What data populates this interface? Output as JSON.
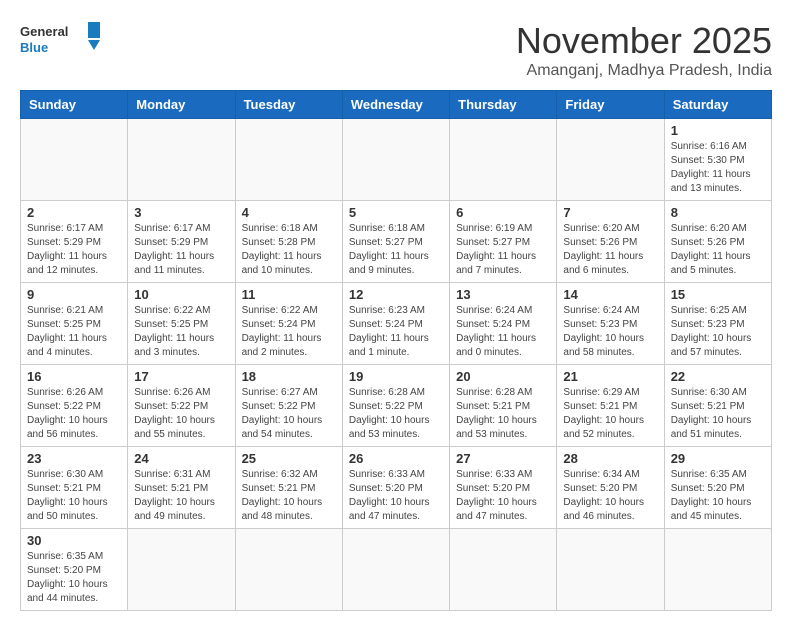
{
  "header": {
    "logo_general": "General",
    "logo_blue": "Blue",
    "month_year": "November 2025",
    "location": "Amanganj, Madhya Pradesh, India"
  },
  "weekdays": [
    "Sunday",
    "Monday",
    "Tuesday",
    "Wednesday",
    "Thursday",
    "Friday",
    "Saturday"
  ],
  "weeks": [
    [
      {
        "day": "",
        "info": ""
      },
      {
        "day": "",
        "info": ""
      },
      {
        "day": "",
        "info": ""
      },
      {
        "day": "",
        "info": ""
      },
      {
        "day": "",
        "info": ""
      },
      {
        "day": "",
        "info": ""
      },
      {
        "day": "1",
        "info": "Sunrise: 6:16 AM\nSunset: 5:30 PM\nDaylight: 11 hours\nand 13 minutes."
      }
    ],
    [
      {
        "day": "2",
        "info": "Sunrise: 6:17 AM\nSunset: 5:29 PM\nDaylight: 11 hours\nand 12 minutes."
      },
      {
        "day": "3",
        "info": "Sunrise: 6:17 AM\nSunset: 5:29 PM\nDaylight: 11 hours\nand 11 minutes."
      },
      {
        "day": "4",
        "info": "Sunrise: 6:18 AM\nSunset: 5:28 PM\nDaylight: 11 hours\nand 10 minutes."
      },
      {
        "day": "5",
        "info": "Sunrise: 6:18 AM\nSunset: 5:27 PM\nDaylight: 11 hours\nand 9 minutes."
      },
      {
        "day": "6",
        "info": "Sunrise: 6:19 AM\nSunset: 5:27 PM\nDaylight: 11 hours\nand 7 minutes."
      },
      {
        "day": "7",
        "info": "Sunrise: 6:20 AM\nSunset: 5:26 PM\nDaylight: 11 hours\nand 6 minutes."
      },
      {
        "day": "8",
        "info": "Sunrise: 6:20 AM\nSunset: 5:26 PM\nDaylight: 11 hours\nand 5 minutes."
      }
    ],
    [
      {
        "day": "9",
        "info": "Sunrise: 6:21 AM\nSunset: 5:25 PM\nDaylight: 11 hours\nand 4 minutes."
      },
      {
        "day": "10",
        "info": "Sunrise: 6:22 AM\nSunset: 5:25 PM\nDaylight: 11 hours\nand 3 minutes."
      },
      {
        "day": "11",
        "info": "Sunrise: 6:22 AM\nSunset: 5:24 PM\nDaylight: 11 hours\nand 2 minutes."
      },
      {
        "day": "12",
        "info": "Sunrise: 6:23 AM\nSunset: 5:24 PM\nDaylight: 11 hours\nand 1 minute."
      },
      {
        "day": "13",
        "info": "Sunrise: 6:24 AM\nSunset: 5:24 PM\nDaylight: 11 hours\nand 0 minutes."
      },
      {
        "day": "14",
        "info": "Sunrise: 6:24 AM\nSunset: 5:23 PM\nDaylight: 10 hours\nand 58 minutes."
      },
      {
        "day": "15",
        "info": "Sunrise: 6:25 AM\nSunset: 5:23 PM\nDaylight: 10 hours\nand 57 minutes."
      }
    ],
    [
      {
        "day": "16",
        "info": "Sunrise: 6:26 AM\nSunset: 5:22 PM\nDaylight: 10 hours\nand 56 minutes."
      },
      {
        "day": "17",
        "info": "Sunrise: 6:26 AM\nSunset: 5:22 PM\nDaylight: 10 hours\nand 55 minutes."
      },
      {
        "day": "18",
        "info": "Sunrise: 6:27 AM\nSunset: 5:22 PM\nDaylight: 10 hours\nand 54 minutes."
      },
      {
        "day": "19",
        "info": "Sunrise: 6:28 AM\nSunset: 5:22 PM\nDaylight: 10 hours\nand 53 minutes."
      },
      {
        "day": "20",
        "info": "Sunrise: 6:28 AM\nSunset: 5:21 PM\nDaylight: 10 hours\nand 53 minutes."
      },
      {
        "day": "21",
        "info": "Sunrise: 6:29 AM\nSunset: 5:21 PM\nDaylight: 10 hours\nand 52 minutes."
      },
      {
        "day": "22",
        "info": "Sunrise: 6:30 AM\nSunset: 5:21 PM\nDaylight: 10 hours\nand 51 minutes."
      }
    ],
    [
      {
        "day": "23",
        "info": "Sunrise: 6:30 AM\nSunset: 5:21 PM\nDaylight: 10 hours\nand 50 minutes."
      },
      {
        "day": "24",
        "info": "Sunrise: 6:31 AM\nSunset: 5:21 PM\nDaylight: 10 hours\nand 49 minutes."
      },
      {
        "day": "25",
        "info": "Sunrise: 6:32 AM\nSunset: 5:21 PM\nDaylight: 10 hours\nand 48 minutes."
      },
      {
        "day": "26",
        "info": "Sunrise: 6:33 AM\nSunset: 5:20 PM\nDaylight: 10 hours\nand 47 minutes."
      },
      {
        "day": "27",
        "info": "Sunrise: 6:33 AM\nSunset: 5:20 PM\nDaylight: 10 hours\nand 47 minutes."
      },
      {
        "day": "28",
        "info": "Sunrise: 6:34 AM\nSunset: 5:20 PM\nDaylight: 10 hours\nand 46 minutes."
      },
      {
        "day": "29",
        "info": "Sunrise: 6:35 AM\nSunset: 5:20 PM\nDaylight: 10 hours\nand 45 minutes."
      }
    ],
    [
      {
        "day": "30",
        "info": "Sunrise: 6:35 AM\nSunset: 5:20 PM\nDaylight: 10 hours\nand 44 minutes."
      },
      {
        "day": "",
        "info": ""
      },
      {
        "day": "",
        "info": ""
      },
      {
        "day": "",
        "info": ""
      },
      {
        "day": "",
        "info": ""
      },
      {
        "day": "",
        "info": ""
      },
      {
        "day": "",
        "info": ""
      }
    ]
  ]
}
